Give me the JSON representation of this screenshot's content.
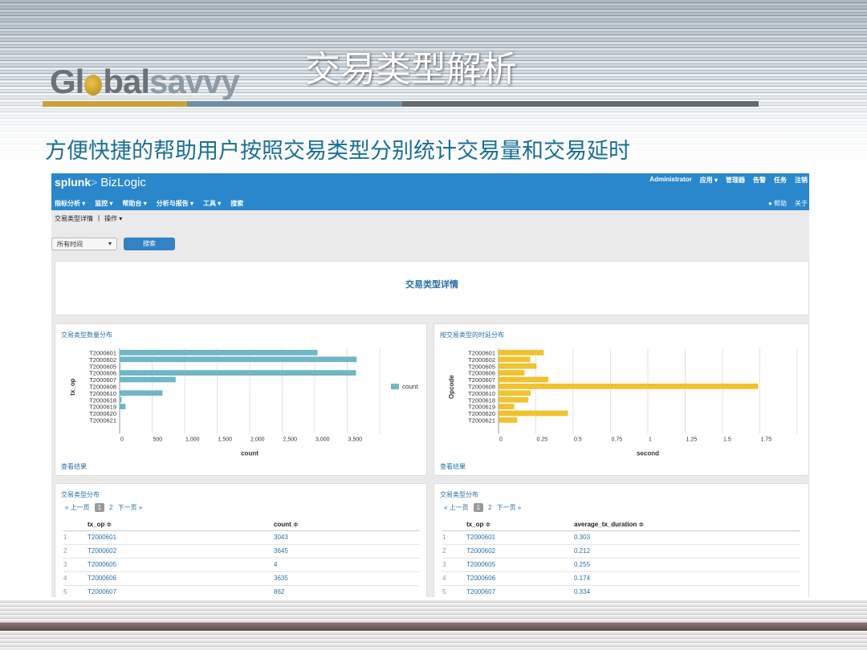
{
  "slide": {
    "logo_left": "Gl",
    "logo_mid": "bal",
    "logo_right": "savvy",
    "title": "交易类型解析",
    "subtitle": "方便快捷的帮助用户按照交易类型分别统计交易量和交易延时"
  },
  "app": {
    "brand_splunk": "splunk",
    "brand_gt": ">",
    "brand_app": "BizLogic",
    "user_links": [
      "Administrator",
      "应用 ▾",
      "管理器",
      "告警",
      "任务",
      "注销"
    ],
    "nav": [
      "指标分析 ▾",
      "监控 ▾",
      "帮助台 ▾",
      "分析与报告 ▾",
      "工具 ▾",
      "搜索"
    ],
    "nav_right": [
      "● 帮助",
      "关于"
    ],
    "subnav": [
      "交易类型详情",
      "|",
      "操作 ▾"
    ],
    "time_select": "所有时间",
    "search_button": "搜索",
    "heading": "交易类型详情",
    "panel1_title": "交易类型数量分布",
    "panel2_title": "按交易类型的时延分布",
    "panel3_title": "交易类型分布",
    "panel4_title": "交易类型分布",
    "view_results": "查看结果",
    "pager": {
      "prev": "« 上一页",
      "cur": "1",
      "next_num": "2",
      "next": "下一页 »"
    },
    "table1": {
      "headers": [
        "tx_op ≑",
        "count ≑"
      ],
      "rows": [
        [
          "1",
          "T2000601",
          "3043"
        ],
        [
          "2",
          "T2000602",
          "3645"
        ],
        [
          "3",
          "T2000605",
          "4"
        ],
        [
          "4",
          "T2000606",
          "3635"
        ],
        [
          "5",
          "T2000607",
          "862"
        ]
      ]
    },
    "table2": {
      "headers": [
        "tx_op ≑",
        "average_tx_duration ≑"
      ],
      "rows": [
        [
          "1",
          "T2000601",
          "0.303"
        ],
        [
          "2",
          "T2000602",
          "0.212"
        ],
        [
          "3",
          "T2000605",
          "0.255"
        ],
        [
          "4",
          "T2000606",
          "0.174"
        ],
        [
          "5",
          "T2000607",
          "0.334"
        ]
      ]
    }
  },
  "chart_data": [
    {
      "type": "bar",
      "orientation": "horizontal",
      "categories": [
        "T2000601",
        "T2000602",
        "T2000605",
        "T2000606",
        "T2000607",
        "T2000608",
        "T2000610",
        "T2000618",
        "T2000619",
        "T2000620",
        "T2000621"
      ],
      "values": [
        3043,
        3645,
        4,
        3635,
        862,
        0,
        660,
        30,
        90,
        0,
        0
      ],
      "xlabel": "count",
      "ylabel": "tx_op",
      "xticks": [
        "0",
        "500",
        "1,000",
        "1,500",
        "2,000",
        "2,500",
        "3,000",
        "3,500"
      ],
      "xlim": [
        0,
        4000
      ],
      "legend": "count",
      "legend_position": "right",
      "color": "#6fb6c6",
      "grid": true
    },
    {
      "type": "bar",
      "orientation": "horizontal",
      "categories": [
        "T2000601",
        "T2000602",
        "T2000605",
        "T2000606",
        "T2000607",
        "T2000608",
        "T2000610",
        "T2000618",
        "T2000619",
        "T2000620",
        "T2000621"
      ],
      "values": [
        0.303,
        0.212,
        0.255,
        0.174,
        0.334,
        1.74,
        0.215,
        0.2,
        0.105,
        0.465,
        0.125
      ],
      "xlabel": "second",
      "ylabel": "Opcode",
      "xticks": [
        "0",
        "0.25",
        "0.5",
        "0.75",
        "1",
        "1.25",
        "1.5",
        "1.75"
      ],
      "xlim": [
        0,
        2
      ],
      "color": "#f2c12e",
      "grid": true
    }
  ]
}
